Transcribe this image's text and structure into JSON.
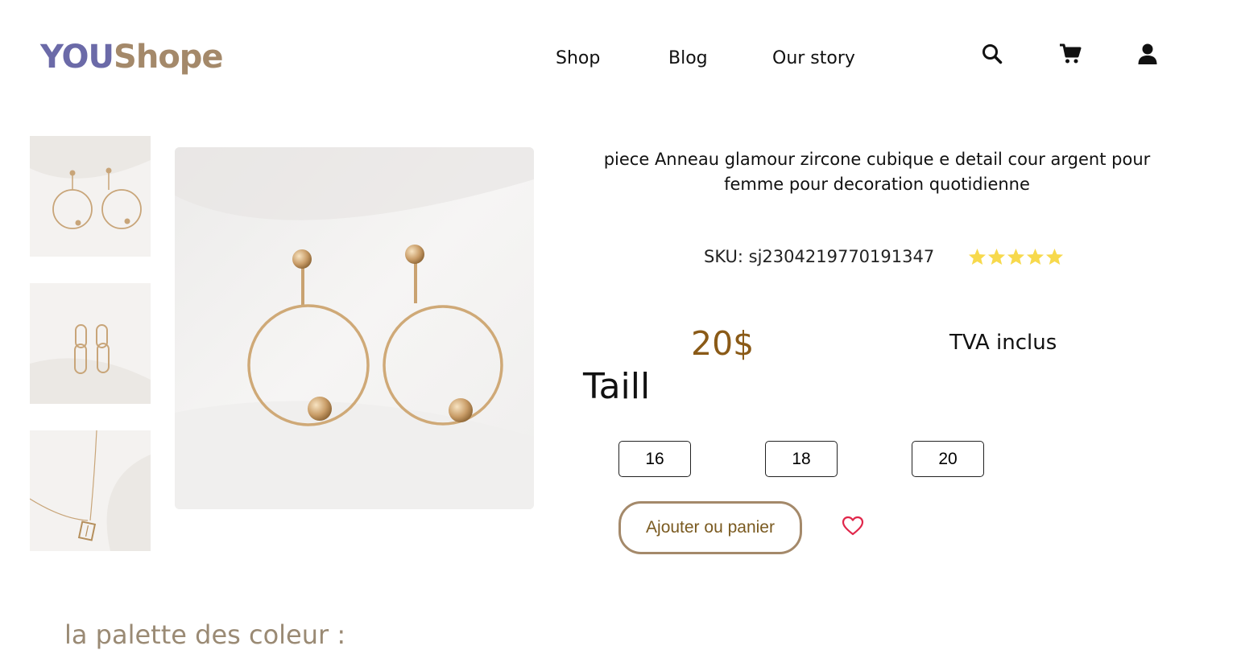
{
  "header": {
    "logo_part1": "YOU",
    "logo_part2": "Shope",
    "nav": [
      "Shop",
      "Blog",
      "Our story"
    ],
    "icons": [
      "search-icon",
      "cart-icon",
      "user-icon"
    ]
  },
  "gallery": {
    "thumbnails": [
      "hoop-earrings",
      "link-earrings",
      "pendant-necklace"
    ],
    "main": "hoop-earrings"
  },
  "product": {
    "title": "piece Anneau glamour zircone cubique e detail cour argent pour femme pour decoration quotidienne",
    "sku": "SKU: sj2304219770191347",
    "rating": 5,
    "price": "20$",
    "tax_note": "TVA inclus",
    "size_label": "Taill",
    "sizes": [
      "16",
      "18",
      "20"
    ],
    "add_to_cart": "Ajouter ou panier"
  },
  "palette_heading": "la palette des coleur :",
  "colors": {
    "logo_you": "#6b6aa8",
    "logo_shope": "#a4896a",
    "price": "#8a5a17",
    "star": "#f7d94c",
    "heart": "#e0264a",
    "button_border": "#a4896a"
  }
}
